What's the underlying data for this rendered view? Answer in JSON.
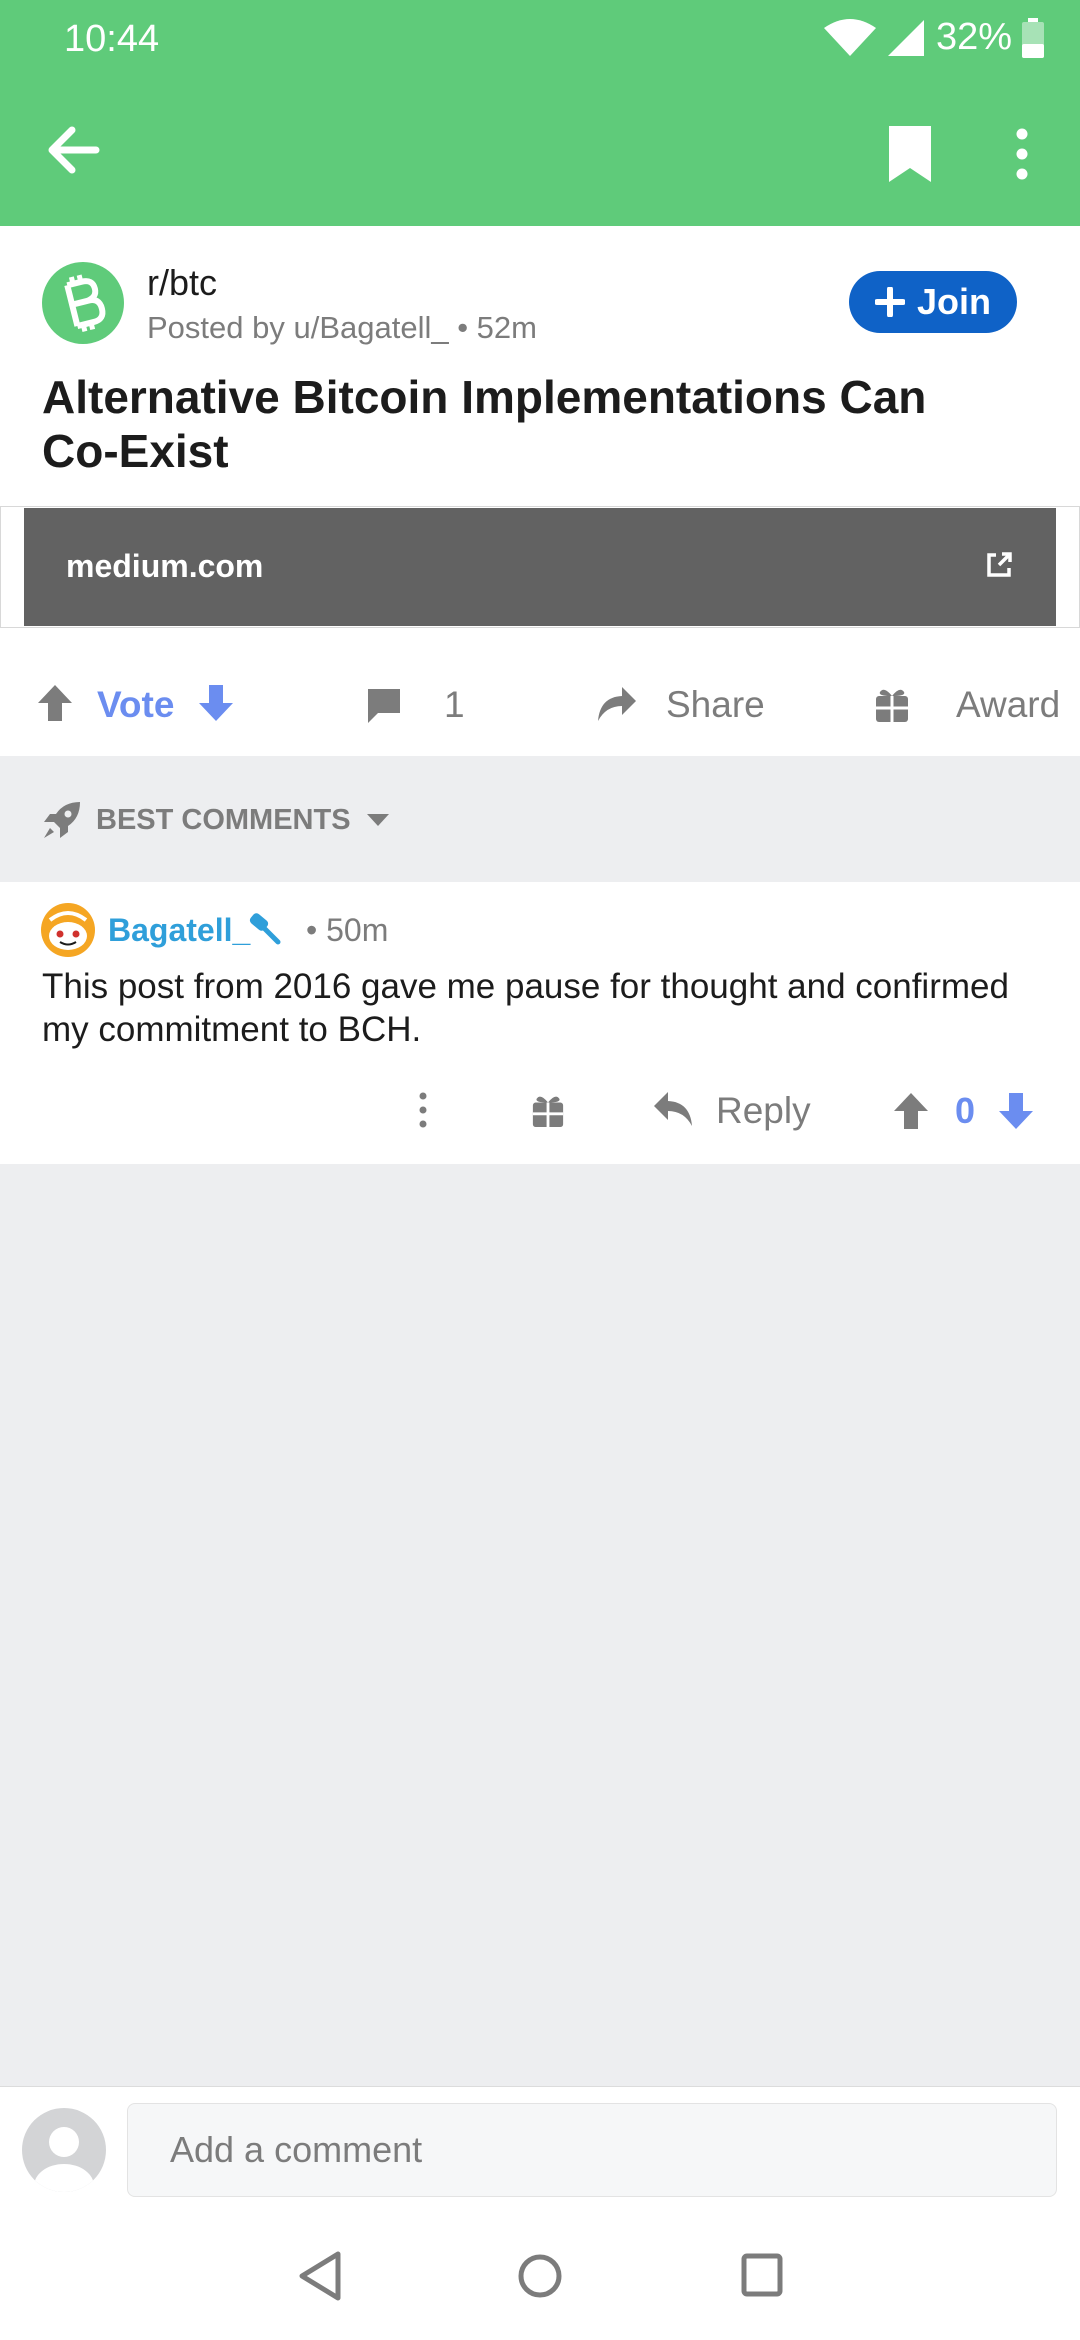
{
  "status_bar": {
    "time": "10:44",
    "battery": "32%"
  },
  "post": {
    "subreddit": "r/btc",
    "meta": "Posted by u/Bagatell_ • 52m",
    "join_label": "Join",
    "title": "Alternative Bitcoin Implementations Can Co-Exist",
    "link_domain": "medium.com"
  },
  "actions": {
    "vote_label": "Vote",
    "comment_count": "1",
    "share_label": "Share",
    "award_label": "Award"
  },
  "sort": {
    "label": "BEST COMMENTS"
  },
  "comment": {
    "author": "Bagatell_",
    "time": "• 50m",
    "body": "This post from 2016 gave me pause for thought and confirmed my commitment to BCH.",
    "reply_label": "Reply",
    "score": "0"
  },
  "composer": {
    "placeholder": "Add a comment"
  },
  "colors": {
    "brand_green": "#5fcb7a",
    "join_blue": "#0f62c7",
    "vote_blue": "#6b8df0",
    "author_blue": "#2f9fda"
  }
}
